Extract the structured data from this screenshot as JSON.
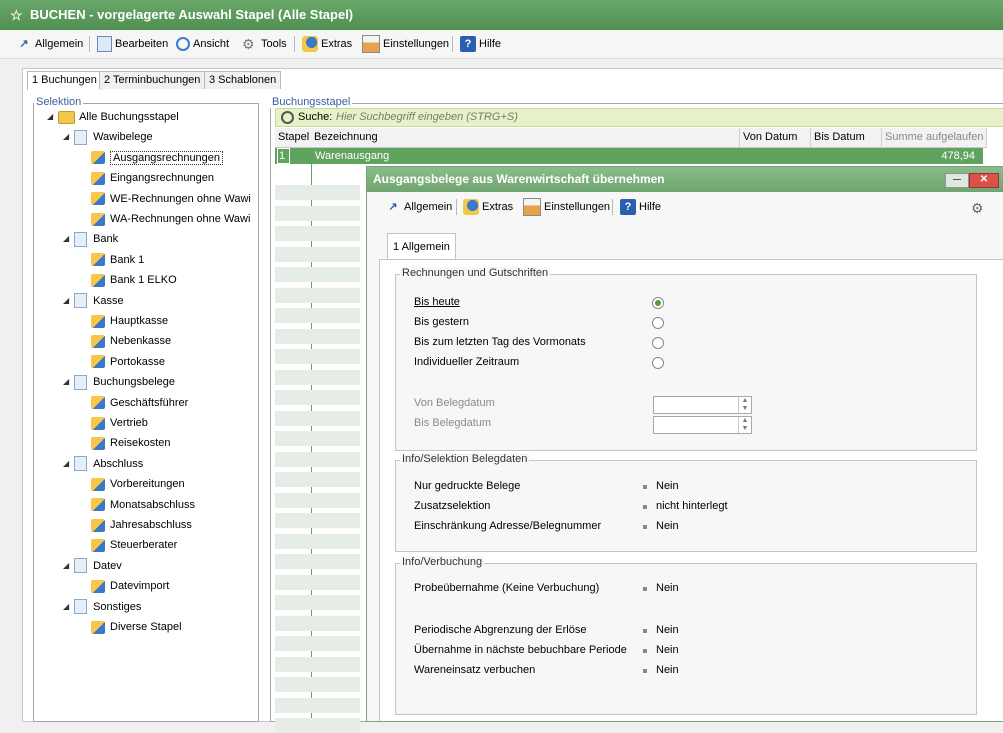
{
  "window": {
    "title": "BUCHEN - vorgelagerte Auswahl Stapel (Alle Stapel)"
  },
  "toolbar": {
    "items": [
      {
        "label": "Allgemein",
        "hotkey": "A"
      },
      {
        "label": "Bearbeiten",
        "hotkey": "B"
      },
      {
        "label": "Ansicht",
        "hotkey": "A"
      },
      {
        "label": "Tools",
        "hotkey": "T"
      },
      {
        "label": "Extras",
        "hotkey": "E"
      },
      {
        "label": "Einstellungen",
        "hotkey": "E"
      },
      {
        "label": "Hilfe",
        "hotkey": "H"
      }
    ]
  },
  "tabs": [
    "1 Buchungen",
    "2 Terminbuchungen",
    "3 Schablonen"
  ],
  "selektion": {
    "label": "Selektion",
    "tree": [
      {
        "label": "Alle Buchungsstapel",
        "level": 0,
        "type": "folder"
      },
      {
        "label": "Wawibelege",
        "level": 1,
        "type": "group"
      },
      {
        "label": "Ausgangsrechnungen",
        "level": 2,
        "type": "leaf",
        "selected": true
      },
      {
        "label": "Eingangsrechnungen",
        "level": 2,
        "type": "leaf"
      },
      {
        "label": "WE-Rechnungen ohne Wawi",
        "level": 2,
        "type": "leaf"
      },
      {
        "label": "WA-Rechnungen ohne Wawi",
        "level": 2,
        "type": "leaf"
      },
      {
        "label": "Bank",
        "level": 1,
        "type": "group"
      },
      {
        "label": "Bank 1",
        "level": 2,
        "type": "leaf"
      },
      {
        "label": "Bank 1 ELKO",
        "level": 2,
        "type": "leaf"
      },
      {
        "label": "Kasse",
        "level": 1,
        "type": "group"
      },
      {
        "label": "Hauptkasse",
        "level": 2,
        "type": "leaf"
      },
      {
        "label": "Nebenkasse",
        "level": 2,
        "type": "leaf"
      },
      {
        "label": "Portokasse",
        "level": 2,
        "type": "leaf"
      },
      {
        "label": "Buchungsbelege",
        "level": 1,
        "type": "group"
      },
      {
        "label": "Geschäftsführer",
        "level": 2,
        "type": "leaf"
      },
      {
        "label": "Vertrieb",
        "level": 2,
        "type": "leaf"
      },
      {
        "label": "Reisekosten",
        "level": 2,
        "type": "leaf"
      },
      {
        "label": "Abschluss",
        "level": 1,
        "type": "group"
      },
      {
        "label": "Vorbereitungen",
        "level": 2,
        "type": "leaf"
      },
      {
        "label": "Monatsabschluss",
        "level": 2,
        "type": "leaf"
      },
      {
        "label": "Jahresabschluss",
        "level": 2,
        "type": "leaf"
      },
      {
        "label": "Steuerberater",
        "level": 2,
        "type": "leaf"
      },
      {
        "label": "Datev",
        "level": 1,
        "type": "group"
      },
      {
        "label": "Datevimport",
        "level": 2,
        "type": "leaf"
      },
      {
        "label": "Sonstiges",
        "level": 1,
        "type": "group"
      },
      {
        "label": "Diverse Stapel",
        "level": 2,
        "type": "leaf"
      }
    ]
  },
  "buchungsstapel": {
    "label": "Buchungsstapel",
    "search_label": "Suche:",
    "search_placeholder": "Hier Suchbegriff eingeben (STRG+S)",
    "columns": [
      "Stapel",
      "Bezeichnung",
      "Von Datum",
      "Bis Datum",
      "Summe aufgelaufen"
    ],
    "rows": [
      {
        "stapel": "1",
        "bezeichnung": "Warenausgang",
        "von": "",
        "bis": "",
        "summe": "478,94"
      }
    ]
  },
  "dialog": {
    "title": "Ausgangsbelege aus Warenwirtschaft übernehmen",
    "toolbar": [
      {
        "label": "Allgemein",
        "hotkey": "A"
      },
      {
        "label": "Extras",
        "hotkey": "E"
      },
      {
        "label": "Einstellungen",
        "hotkey": "E"
      },
      {
        "label": "Hilfe",
        "hotkey": "H"
      }
    ],
    "tab": "1 Allgemein",
    "rechnungen": {
      "label": "Rechnungen und Gutschriften",
      "options": [
        {
          "label": "Bis heute",
          "selected": true
        },
        {
          "label": "Bis gestern",
          "selected": false
        },
        {
          "label": "Bis zum letzten Tag des Vormonats",
          "selected": false
        },
        {
          "label": "Individueller Zeitraum",
          "selected": false
        }
      ],
      "von_label": "Von Belegdatum",
      "bis_label": "Bis Belegdatum",
      "von_value": "",
      "bis_value": ""
    },
    "info_selektion": {
      "label": "Info/Selektion Belegdaten",
      "rows": [
        {
          "label": "Nur gedruckte Belege",
          "value": "Nein"
        },
        {
          "label": "Zusatzselektion",
          "value": "nicht hinterlegt"
        },
        {
          "label": "Einschränkung Adresse/Belegnummer",
          "value": "Nein"
        }
      ]
    },
    "info_verbuchung": {
      "label": "Info/Verbuchung",
      "rows": [
        {
          "label": "Probeübernahme (Keine Verbuchung)",
          "value": "Nein"
        },
        {
          "label": "Periodische Abgrenzung der Erlöse",
          "value": "Nein"
        },
        {
          "label": "Übernahme in nächste bebuchbare Periode",
          "value": "Nein"
        },
        {
          "label": "Wareneinsatz verbuchen",
          "value": "Nein"
        }
      ]
    }
  },
  "colors": {
    "title_green": "#5a9a5c",
    "selection_green": "#5fa35f",
    "search_bg": "#e7f2c8"
  }
}
